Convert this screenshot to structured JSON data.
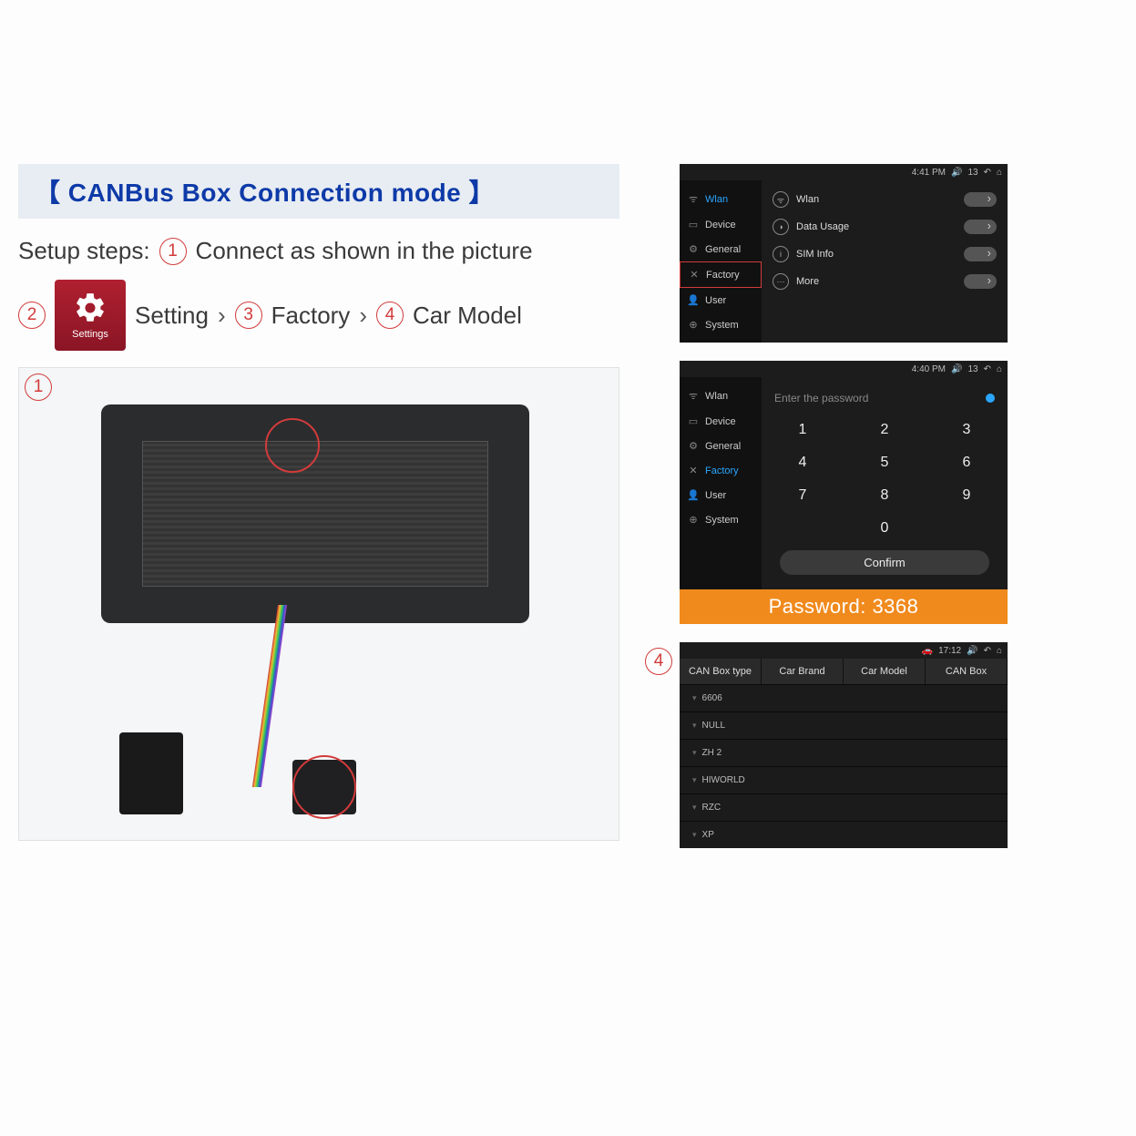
{
  "title": "CANBus Box Connection mode",
  "setup_label": "Setup steps:",
  "step1_text": "Connect as shown in the picture",
  "step2_label": "Setting",
  "step3_label": "Factory",
  "step4_label": "Car Model",
  "settings_icon_label": "Settings",
  "markers": {
    "m1": "1",
    "m2": "2",
    "m3": "3",
    "m4": "4"
  },
  "screen2": {
    "time": "4:41 PM",
    "battery": "13",
    "nav": [
      "Wlan",
      "Device",
      "General",
      "Factory",
      "User",
      "System"
    ],
    "active": "Wlan",
    "highlight": "Factory",
    "rows": [
      "Wlan",
      "Data Usage",
      "SIM Info",
      "More"
    ]
  },
  "screen3": {
    "time": "4:40 PM",
    "battery": "13",
    "nav": [
      "Wlan",
      "Device",
      "General",
      "Factory",
      "User",
      "System"
    ],
    "active": "Factory",
    "placeholder": "Enter the password",
    "keys": [
      "1",
      "2",
      "3",
      "4",
      "5",
      "6",
      "7",
      "8",
      "9",
      "",
      "0",
      ""
    ],
    "confirm": "Confirm",
    "banner_label": "Password:",
    "banner_value": "3368"
  },
  "screen4": {
    "time": "17:12",
    "tabs": [
      "CAN Box type",
      "Car Brand",
      "Car Model",
      "CAN Box"
    ],
    "items": [
      "6606",
      "NULL",
      "ZH 2",
      "HIWORLD",
      "RZC",
      "XP"
    ]
  }
}
